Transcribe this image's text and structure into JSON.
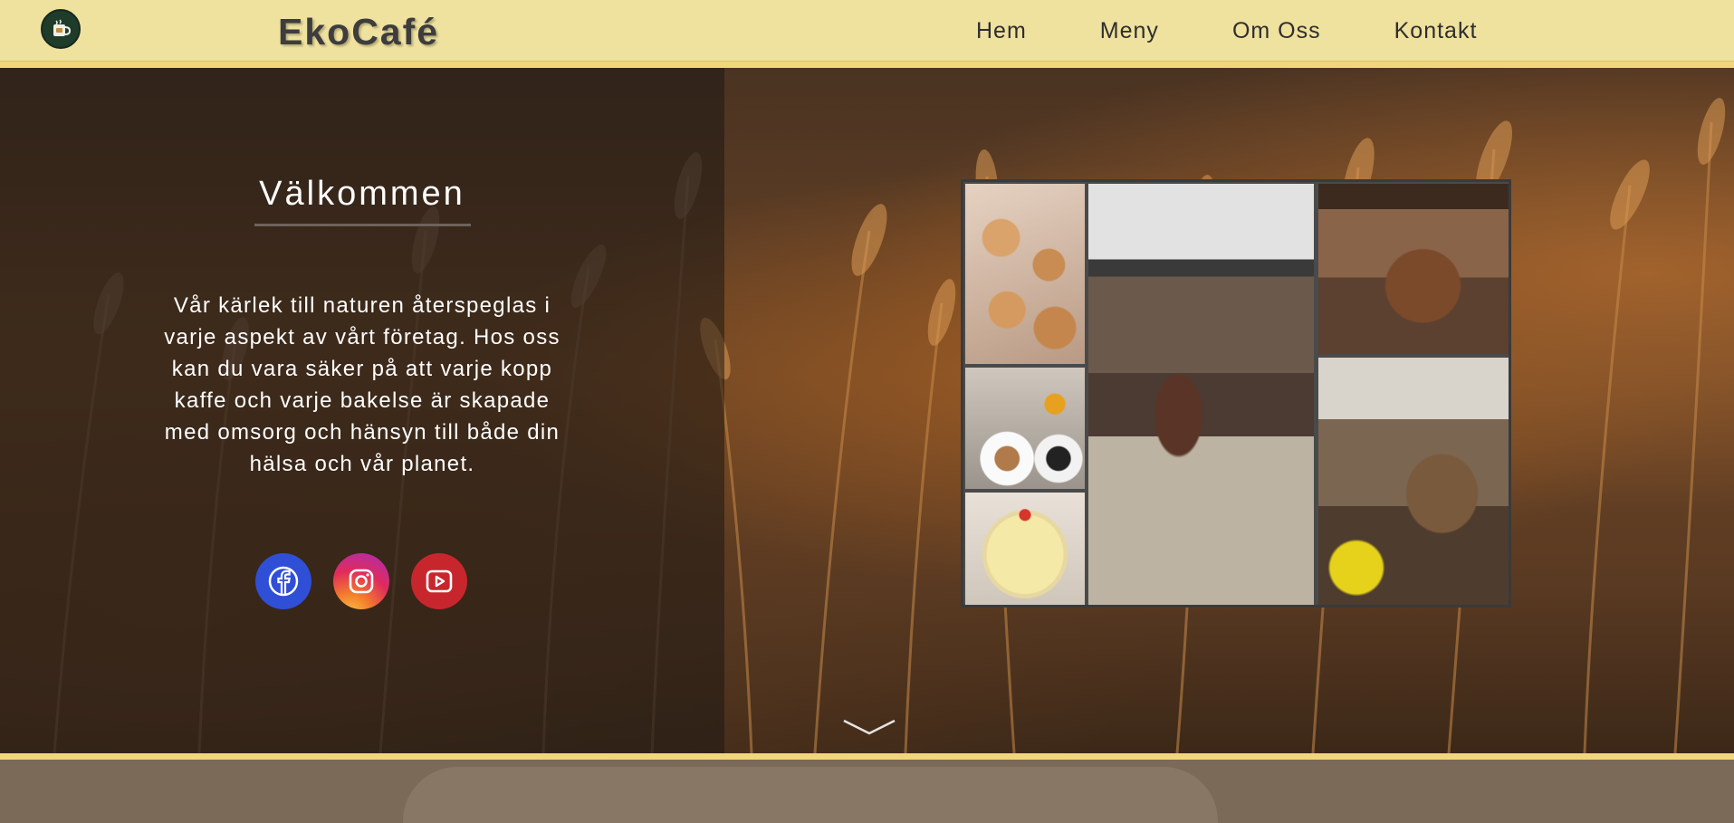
{
  "header": {
    "brand": "EkoCafé",
    "logo_icon": "coffee-cup-icon",
    "nav": [
      "Hem",
      "Meny",
      "Om Oss",
      "Kontakt"
    ],
    "colors": {
      "bar": "#efe19e",
      "accent": "#f1d67c",
      "text": "#3d3d3d"
    }
  },
  "hero": {
    "title": "Välkommen",
    "intro": "Vår kärlek till naturen återspeglas i varje aspekt av vårt företag. Hos oss kan du vara säker på att varje kopp kaffe och varje bakelse är skapade med omsorg och hänsyn till både din hälsa och vår planet.",
    "social": [
      {
        "name": "facebook-icon",
        "color": "#2f4fd6"
      },
      {
        "name": "instagram-icon",
        "color": "#e02b5c"
      },
      {
        "name": "youtube-icon",
        "color": "#c8262d"
      }
    ],
    "scroll_icon": "chevron-down-icon"
  },
  "gallery": {
    "photos": [
      "cinnamon-buns",
      "cafe-table-candles",
      "cheesecake",
      "cafe-interior",
      "guests-dining",
      "group-at-table"
    ]
  }
}
